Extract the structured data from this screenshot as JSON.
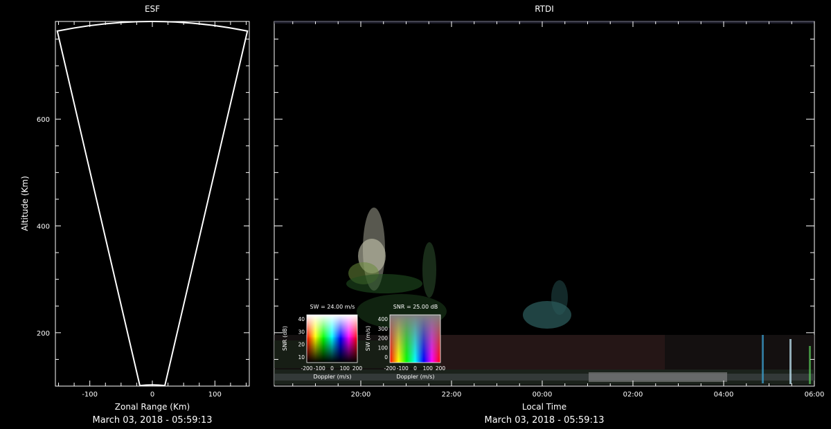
{
  "chart_data": [
    {
      "type": "other",
      "title": "ESF",
      "xlabel": "Zonal Range (Km)",
      "ylabel": "Altitude (Km)",
      "xticks": [
        -100,
        0,
        100
      ],
      "yticks": [
        200,
        400,
        600
      ],
      "xlim": [
        -155,
        155
      ],
      "ylim": [
        100,
        783
      ],
      "footer": "March 03, 2018 - 05:59:13",
      "colors": {
        "background": "#000000",
        "outline": "#ffffff"
      }
    },
    {
      "type": "heatmap",
      "title": "RTDI",
      "xlabel": "Local Time",
      "xticks": [
        "20:00",
        "22:00",
        "00:00",
        "02:00",
        "04:00",
        "06:00"
      ],
      "footer": "March 03, 2018 - 05:59:13",
      "insets": [
        {
          "title": "SW = 24.00 m/s",
          "xlabel": "Doppler (m/s)",
          "ylabel": "SNR (dB)",
          "xticks": [
            "-200",
            "-100",
            "0",
            "100",
            "200"
          ],
          "yticks": [
            "10",
            "20",
            "30",
            "40"
          ]
        },
        {
          "title": "SNR = 25.00 dB",
          "xlabel": "Doppler (m/s)",
          "ylabel": "SW (m/s)",
          "xticks": [
            "-200",
            "-100",
            "0",
            "100",
            "200"
          ],
          "yticks": [
            "0",
            "100",
            "200",
            "300",
            "400"
          ]
        }
      ]
    }
  ]
}
